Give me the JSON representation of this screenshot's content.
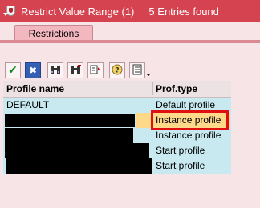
{
  "window": {
    "title": "Restrict Value Range (1)     5 Entries found"
  },
  "tabs": [
    {
      "label": "Restrictions"
    }
  ],
  "toolbar": {
    "buttons": [
      {
        "name": "continue",
        "icon": "check-icon",
        "glyph": "✔"
      },
      {
        "name": "cancel",
        "icon": "x-icon",
        "glyph": "✖"
      },
      {
        "name": "find",
        "icon": "binoculars-icon",
        "glyph": "⌕"
      },
      {
        "name": "find-next",
        "icon": "binoculars-plus-icon",
        "glyph": "⌕"
      },
      {
        "name": "sort",
        "icon": "sort-icon",
        "glyph": "⇅"
      },
      {
        "name": "help",
        "icon": "help-icon",
        "glyph": "?"
      },
      {
        "name": "export",
        "icon": "export-icon",
        "glyph": "▤"
      }
    ]
  },
  "table": {
    "columns": [
      "Profile name",
      "Prof.type"
    ],
    "rows": [
      {
        "name": "DEFAULT",
        "type": "Default profile",
        "redacted": false,
        "selected": false
      },
      {
        "name": "",
        "type": "Instance profile",
        "redacted": true,
        "selected": true
      },
      {
        "name": "",
        "type": "Instance profile",
        "redacted": true,
        "selected": false
      },
      {
        "name": "",
        "type": "Start profile",
        "redacted": true,
        "selected": false
      },
      {
        "name": "",
        "type": "Start profile",
        "redacted": true,
        "selected": false
      }
    ]
  },
  "colors": {
    "titlebar": "#d4434f",
    "background": "#f7e4e6",
    "row_default": "#c7e9ef",
    "row_selected": "#ffd98a",
    "highlight_border": "#e01010"
  }
}
